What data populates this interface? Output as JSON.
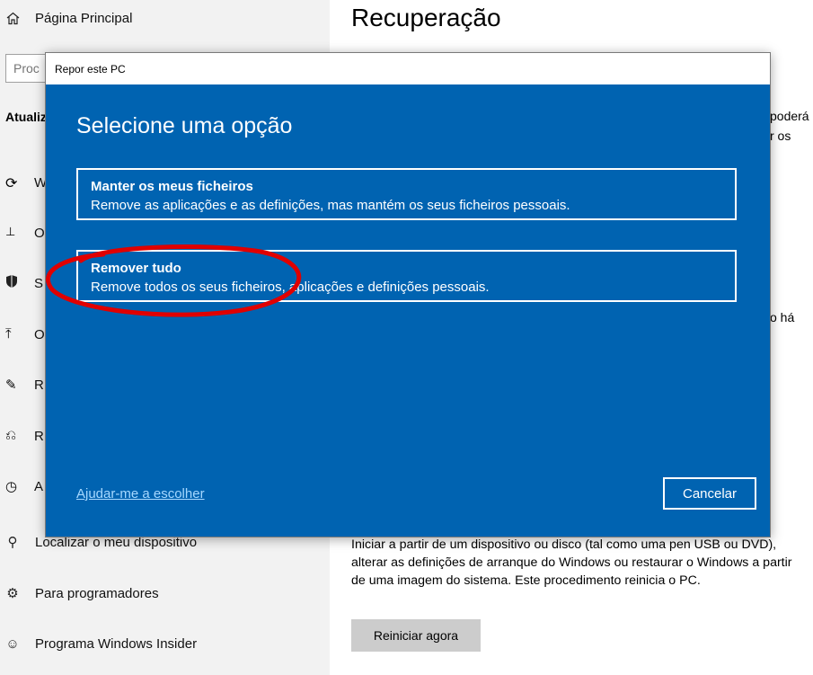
{
  "sidebar": {
    "home_label": "Página Principal",
    "search_placeholder": "Proc",
    "section_heading": "Atualiz",
    "edge_letters": [
      "W",
      "O",
      "S",
      "O",
      "R",
      "R",
      "A"
    ],
    "find_device_label": "Localizar o meu dispositivo",
    "developers_label": "Para programadores",
    "insider_label": "Programa Windows Insider"
  },
  "main": {
    "title": "Recuperação",
    "frag1": "poderá",
    "frag2": "r os",
    "frag3": "o há",
    "advanced_desc": "Iniciar a partir de um dispositivo ou disco (tal como uma pen USB ou DVD), alterar as definições de arranque do Windows ou restaurar o Windows a partir de uma imagem do sistema. Este procedimento reinicia o PC.",
    "restart_label": "Reiniciar agora"
  },
  "dialog": {
    "title": "Repor este PC",
    "heading": "Selecione uma opção",
    "options": [
      {
        "title": "Manter os meus ficheiros",
        "desc": "Remove as aplicações e as definições, mas mantém os seus ficheiros pessoais."
      },
      {
        "title": "Remover tudo",
        "desc": "Remove todos os seus ficheiros, aplicações e definições pessoais."
      }
    ],
    "help_link": "Ajudar-me a escolher",
    "cancel_label": "Cancelar"
  },
  "colors": {
    "dialog_blue": "#0063b1",
    "link_blue": "#a6d8ff",
    "annotation_red": "#e00000"
  }
}
